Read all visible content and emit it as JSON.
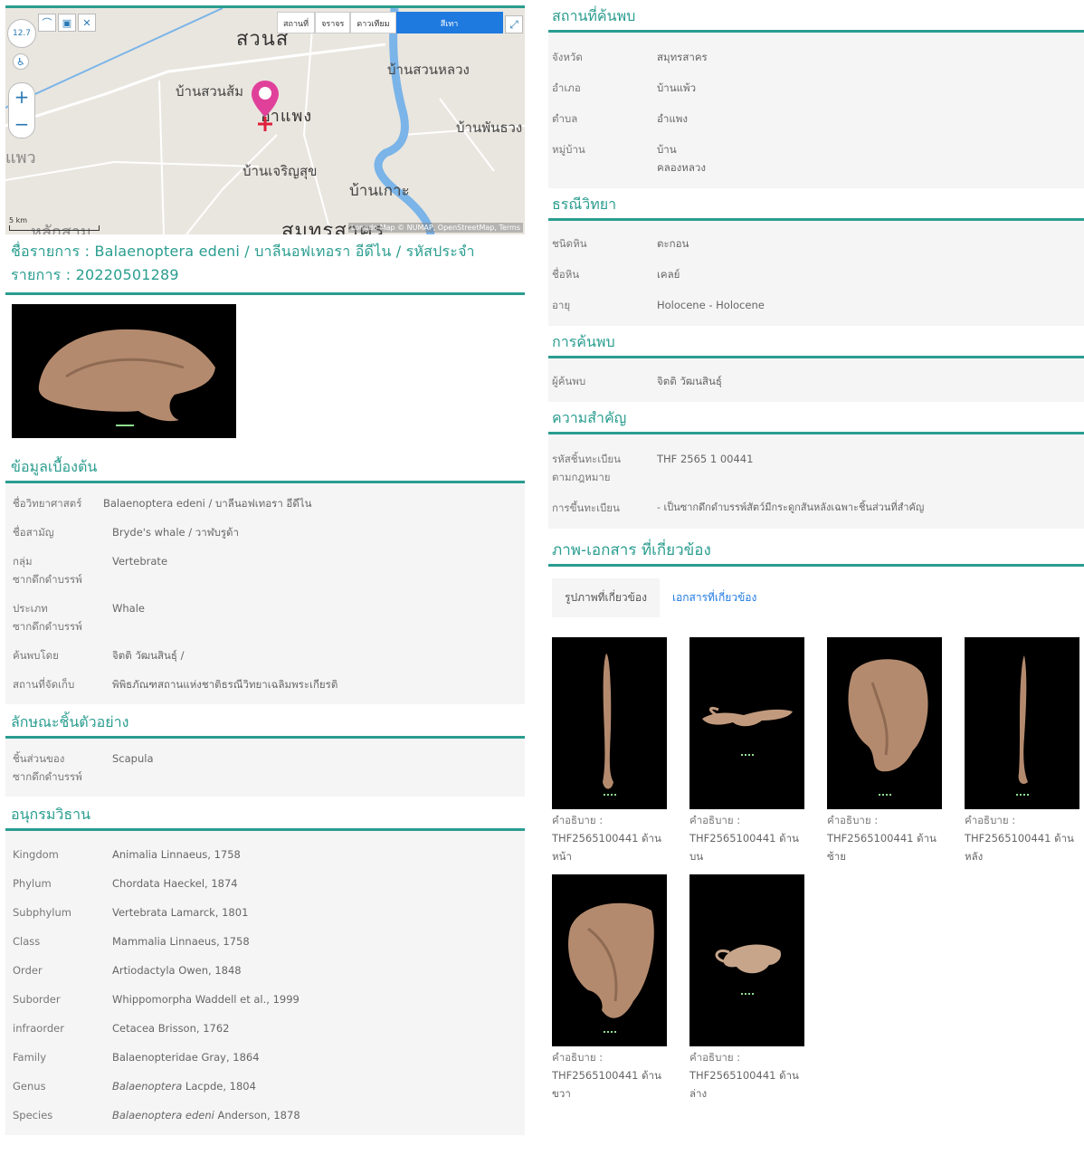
{
  "map": {
    "zoom_level": "12.7",
    "places": {
      "suan": "สวนส",
      "ban_suan_luang": "บ้านสวนหลวง",
      "ban_suan_som": "บ้านสวนส้ม",
      "am_phaeng": "อำแพง",
      "ban_phan_suang": "บ้านพันธวง",
      "phaeo": "แพว",
      "ban_charoen_suk": "บ้านเจริญสุข",
      "ban_ko": "บ้านเกาะ",
      "lak_sam": "หลักสาม",
      "samut_sakhon": "สมุทรสาคร"
    },
    "buttons": [
      "สถานที่",
      "จราจร",
      "ดาวเทียม",
      "สีเทา"
    ],
    "scale_label": "5 km",
    "attribution": "Longdo Map © NUMAP, OpenStreetMap, Terms"
  },
  "record": {
    "title": "ชื่อรายการ : Balaenoptera edeni / บาลีนอฟเทอรา อีดีไน / รหัสประจำรายการ : 20220501289"
  },
  "basic_info": {
    "title": "ข้อมูลเบื้องต้น",
    "rows": [
      {
        "k": "ชื่อวิทยาศาสตร์",
        "v": "Balaenoptera edeni / บาลีนอฟเทอรา อีดีไน"
      },
      {
        "k": "ชื่อสามัญ",
        "v": "Bryde's whale / วาฬบรูด้า"
      },
      {
        "k": "กลุ่มซากดึกดำบรรพ์",
        "v": "Vertebrate"
      },
      {
        "k": "ประเภทซากดึกดำบรรพ์",
        "v": "Whale"
      },
      {
        "k": "ค้นพบโดย",
        "v": "จิตติ วัฒนสินธุ์ /"
      },
      {
        "k": "สถานที่จัดเก็บ",
        "v": "พิพิธภัณฑสถานแห่งชาติธรณีวิทยาเฉลิมพระเกียรติ"
      }
    ]
  },
  "specimen": {
    "title": "ลักษณะชิ้นตัวอย่าง",
    "rows": [
      {
        "k": "ชิ้นส่วนของซากดึกดำบรรพ์",
        "v": "Scapula"
      }
    ]
  },
  "taxonomy": {
    "title": "อนุกรมวิธาน",
    "rows": [
      {
        "k": "Kingdom",
        "v": "Animalia Linnaeus, 1758"
      },
      {
        "k": "Phylum",
        "v": "Chordata Haeckel, 1874"
      },
      {
        "k": "Subphylum",
        "v": "Vertebrata Lamarck, 1801"
      },
      {
        "k": "Class",
        "v": "Mammalia Linnaeus, 1758"
      },
      {
        "k": "Order",
        "v": "Artiodactyla Owen, 1848"
      },
      {
        "k": "Suborder",
        "v": "Whippomorpha Waddell et al., 1999"
      },
      {
        "k": "infraorder",
        "v": "Cetacea Brisson, 1762"
      },
      {
        "k": "Family",
        "v": "Balaenopteridae Gray, 1864"
      },
      {
        "k": "Genus",
        "v_italic": "Balaenoptera",
        "v": " Lacpde, 1804"
      },
      {
        "k": "Species",
        "v_italic": "Balaenoptera edeni",
        "v": " Anderson, 1878"
      }
    ]
  },
  "discovery_site": {
    "title": "สถานที่ค้นพบ",
    "rows": [
      {
        "k": "จังหวัด",
        "v": "สมุทรสาคร"
      },
      {
        "k": "อำเภอ",
        "v": "บ้านแพ้ว"
      },
      {
        "k": "ตำบล",
        "v": "อำแพง"
      },
      {
        "k": "หมู่บ้าน",
        "v": "บ้านคลองหลวง"
      }
    ]
  },
  "geology": {
    "title": "ธรณีวิทยา",
    "rows": [
      {
        "k": "ชนิดหิน",
        "v": "ตะกอน"
      },
      {
        "k": "ชื่อหิน",
        "v": "เคลย์"
      },
      {
        "k": "อายุ",
        "v": "Holocene - Holocene"
      }
    ]
  },
  "discovery": {
    "title": "การค้นพบ",
    "rows": [
      {
        "k": "ผู้ค้นพบ",
        "v": "จิตติ วัฒนสินธุ์"
      }
    ]
  },
  "importance": {
    "title": "ความสำคัญ",
    "rows": [
      {
        "k": "รหัสชิ้นทะเบียนตามกฎหมาย",
        "v": "THF 2565 1 00441"
      },
      {
        "k": "การขึ้นทะเบียน",
        "v": "- เป็นซากดึกดำบรรพ์สัตว์มีกระดูกสันหลังเฉพาะชิ้นส่วนที่สำคัญ"
      }
    ]
  },
  "media": {
    "title": "ภาพ-เอกสาร ที่เกี่ยวข้อง",
    "tab_images": "รูปภาพที่เกี่ยวข้อง",
    "tab_docs": "เอกสารที่เกี่ยวข้อง",
    "caption_label": "คำอธิบาย :",
    "items": [
      {
        "caption": "THF2565100441 ด้านหน้า"
      },
      {
        "caption": "THF2565100441 ด้านบน"
      },
      {
        "caption": "THF2565100441 ด้านซ้าย"
      },
      {
        "caption": "THF2565100441 ด้านหลัง"
      },
      {
        "caption": "THF2565100441 ด้านขวา"
      },
      {
        "caption": "THF2565100441 ด้านล่าง"
      }
    ]
  },
  "colors": {
    "accent": "#2a9d8f",
    "link": "#1f7ae0",
    "pin": "#e0409a"
  }
}
